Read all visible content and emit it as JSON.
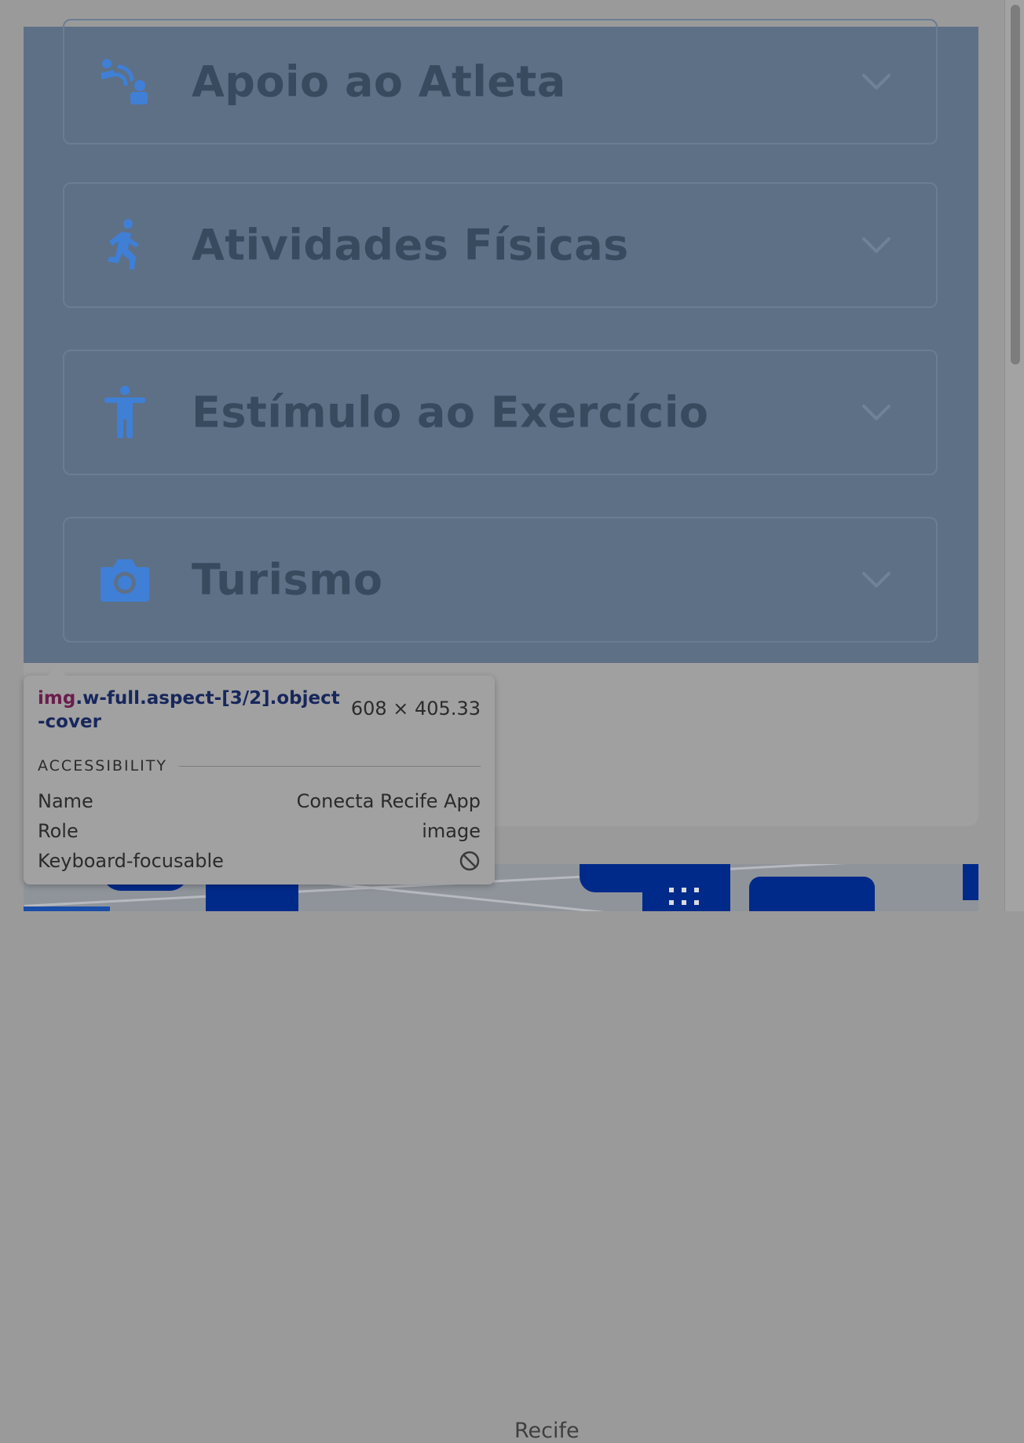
{
  "accordion": {
    "items": [
      {
        "label": "Apoio ao Atleta",
        "icon": "athlete-support-icon"
      },
      {
        "label": "Atividades Físicas",
        "icon": "running-person-icon"
      },
      {
        "label": "Estímulo ao Exercício",
        "icon": "accessibility-person-icon"
      },
      {
        "label": "Turismo",
        "icon": "camera-icon"
      }
    ]
  },
  "card": {
    "partial_text": "Recife"
  },
  "inspector_tooltip": {
    "tag": "img",
    "classes": ".w-full.aspect-[3/2].object-cover",
    "size": "608 × 405.33",
    "section_title": "ACCESSIBILITY",
    "rows": [
      {
        "key": "Name",
        "value": "Conecta Recife App"
      },
      {
        "key": "Role",
        "value": "image"
      },
      {
        "key": "Keyboard-focusable",
        "value": ""
      }
    ],
    "not_focusable_icon": "no-entry-icon"
  },
  "colors": {
    "highlight_overlay": "#5e7086",
    "icon_blue": "#3f7fd6",
    "label_text": "#374a5e",
    "map_building": "#002a8a"
  }
}
